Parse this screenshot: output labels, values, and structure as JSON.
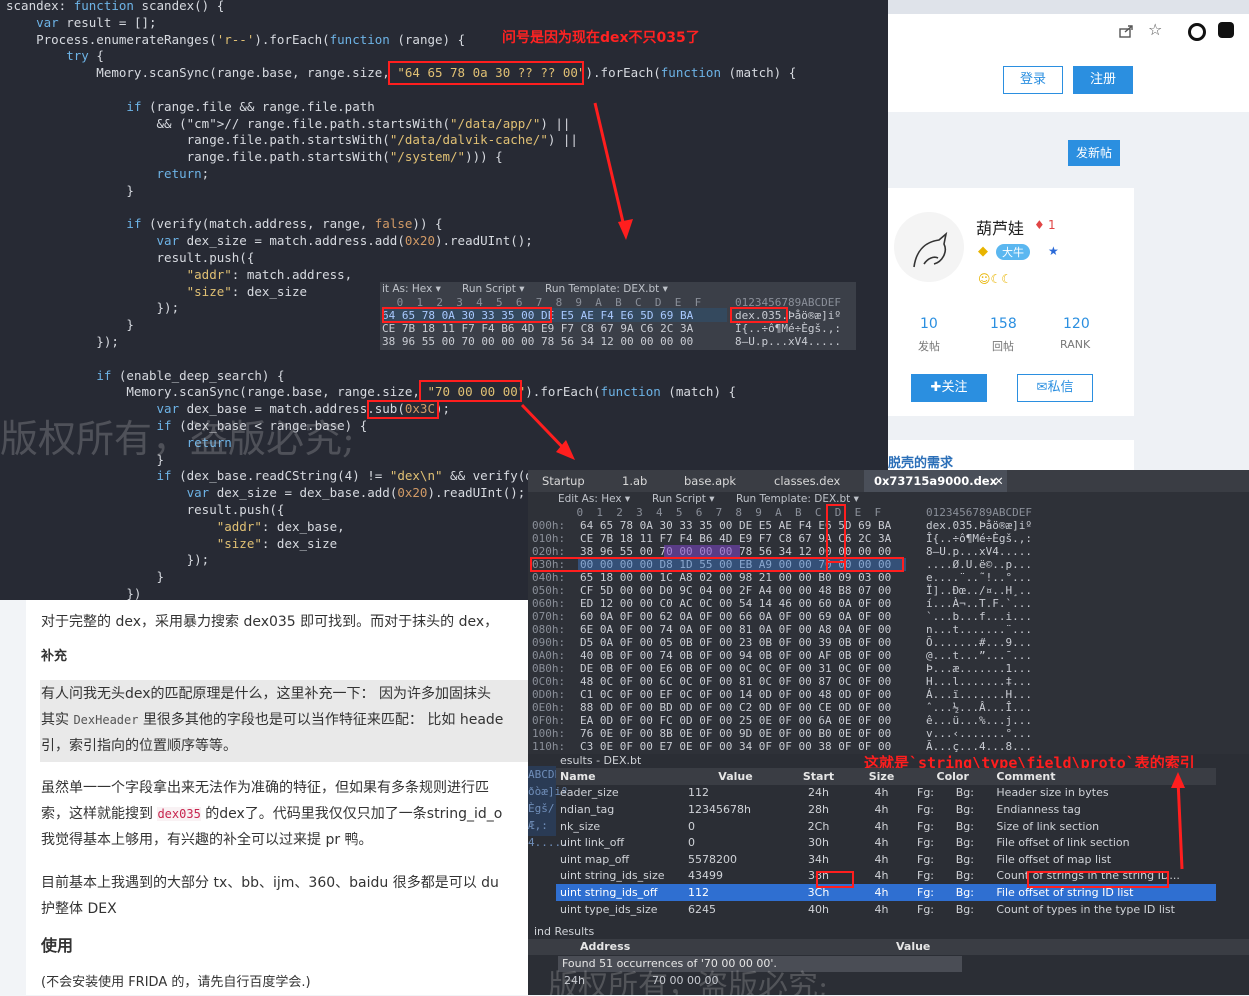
{
  "editor": {
    "lines": [
      "scandex: function scandex() {",
      "    var result = [];",
      "    Process.enumerateRanges('r--').forEach(function (range) {",
      "        try {",
      "            Memory.scanSync(range.base, range.size, \"64 65 78 0a 30 ?? ?? 00\").forEach(function (match) {",
      "",
      "                if (range.file && range.file.path",
      "                    && (// range.file.path.startsWith(\"/data/app/\") ||",
      "                        range.file.path.startsWith(\"/data/dalvik-cache/\") ||",
      "                        range.file.path.startsWith(\"/system/\"))) {",
      "                    return;",
      "                }",
      "",
      "                if (verify(match.address, range, false)) {",
      "                    var dex_size = match.address.add(0x20).readUInt();",
      "                    result.push({",
      "                        \"addr\": match.address,",
      "                        \"size\": dex_size",
      "                    });",
      "                }",
      "            });",
      "",
      "            if (enable_deep_search) {",
      "                Memory.scanSync(range.base, range.size, \"70 00 00 00\").forEach(function (match) {",
      "                    var dex_base = match.address.sub(0x3C);",
      "                    if (dex_base < range.base) {",
      "                        return",
      "                    }",
      "                    if (dex_base.readCString(4) != \"dex\\n\" && verify(d",
      "                        var dex_size = dex_base.add(0x20).readUInt();",
      "                        result.push({",
      "                            \"addr\": dex_base,",
      "                            \"size\": dex_size",
      "                        });",
      "                    }",
      "                })",
      "            }"
    ],
    "annotation_top": "问号是因为现在dex不只035了",
    "watermark": "版权所有，盗版必究;"
  },
  "hexpopup": {
    "toolbar": [
      "it As: Hex ▾",
      "Run Script ▾",
      "Run Template: DEX.bt ▾"
    ],
    "header": " 0  1  2  3  4  5  6  7  8  9  A  B  C  D  E  F",
    "ascii_header": "0123456789ABCDEF",
    "rows": [
      {
        "hex": "64 65 78 0A 30 33 35 00 DE E5 AE F4 E6 5D 69 BA",
        "ascii": "dex.035.Þåö®æ]iº"
      },
      {
        "hex": "CE 7B 18 11 F7 F4 B6 4D E9 F7 C8 67 9A C6 2C 3A",
        "ascii": "Î{..÷ô¶Mé÷Ègš.,:"
      },
      {
        "hex": "38 96 55 00 70 00 00 00 78 56 34 12 00 00 00 00",
        "ascii": "8–U.p...xV4....."
      }
    ]
  },
  "web": {
    "login": "登录",
    "register": "注册",
    "post": "发新帖",
    "username": "葫芦娃",
    "badge_count": "1",
    "rank_badge": "大牛",
    "stats": [
      {
        "value": "10",
        "label": "发帖"
      },
      {
        "value": "158",
        "label": "回帖"
      },
      {
        "value": "120",
        "label": "RANK"
      }
    ],
    "follow": "关注",
    "message": "私信",
    "link_text": "脱壳的需求"
  },
  "article": {
    "p1": "对于完整的 dex，采用暴力搜索 dex035 即可找到。而对于抹头的 dex，",
    "h_supplement": "补充",
    "p2a": "有人问我无头dex的匹配原理是什么，这里补充一下：  因为许多加固抹头",
    "p2b_pre": "其实 ",
    "p2b_code": "DexHeader",
    "p2b_post": " 里很多其他的字段也是可以当作特征来匹配：  比如 heade",
    "p2c": "引，索引指向的位置顺序等等。",
    "p3a": "虽然单一一个字段拿出来无法作为准确的特征，但如果有多条规则进行匹",
    "p3b_pre": "索，这样就能搜到 ",
    "p3b_code": "dex035",
    "p3b_post": " 的dex了。代码里我仅仅只加了一条string_id_o",
    "p3c": "我觉得基本上够用，有兴趣的补全可以过来提 pr 鸭。",
    "p4a": "目前基本上我遇到的大部分 tx、bb、ijm、360、baidu 很多都是可以 du",
    "p4b": "护整体 DEX",
    "h_use": "使用",
    "p5": "(不会安装使用 FRIDA 的，请先自行百度学会.)"
  },
  "hexeditor": {
    "tabs": [
      "Startup",
      "1.ab",
      "base.apk",
      "classes.dex",
      "0x73715a9000.dex"
    ],
    "toolbar": [
      "Edit As: Hex ▾",
      "Run Script ▾",
      "Run Template: DEX.bt ▾"
    ],
    "header": "    0  1  2  3  4  5  6  7  8  9  A  B  C  D  E  F",
    "ascii_header": "0123456789ABCDEF",
    "rows": [
      {
        "addr": "000h:",
        "hex": "64 65 78 0A 30 33 35 00 DE E5 AE F4 E6 5D 69 BA",
        "ascii": "dex.035.Þåö®æ]iº"
      },
      {
        "addr": "010h:",
        "hex": "CE 7B 18 11 F7 F4 B6 4D E9 F7 C8 67 9A C6 2C 3A",
        "ascii": "Î{..÷ô¶Mé÷Ègš.,:"
      },
      {
        "addr": "020h:",
        "hex": "38 96 55 00 70 00 00 00 78 56 34 12 00 00 00 00",
        "ascii": "8–U.p...xV4....."
      },
      {
        "addr": "030h:",
        "hex": "00 00 00 00 D8 1D 55 00 EB A9 00 00 70 00 00 00",
        "ascii": "....Ø.U.ë©..p..."
      },
      {
        "addr": "040h:",
        "hex": "65 18 00 00 1C A8 02 00 98 21 00 00 B0 09 03 00",
        "ascii": "e....¨..˜!..°..."
      },
      {
        "addr": "050h:",
        "hex": "CF 5D 00 00 D0 9C 04 00 2F A4 00 00 48 B8 07 00",
        "ascii": "Ï]..Ðœ../¤..H¸.."
      },
      {
        "addr": "060h:",
        "hex": "ED 12 00 00 C0 AC 0C 00 54 14 46 00 60 0A 0F 00",
        "ascii": "í...À¬..T.F.`..."
      },
      {
        "addr": "070h:",
        "hex": "60 0A 0F 00 62 0A 0F 00 66 0A 0F 00 69 0A 0F 00",
        "ascii": "`...b...f...i..."
      },
      {
        "addr": "080h:",
        "hex": "6E 0A 0F 00 74 0A 0F 00 81 0A 0F 00 A8 0A 0F 00",
        "ascii": "n...t.......¨..."
      },
      {
        "addr": "090h:",
        "hex": "D5 0A 0F 00 05 0B 0F 00 23 0B 0F 00 39 0B 0F 00",
        "ascii": "Õ.......#...9..."
      },
      {
        "addr": "0A0h:",
        "hex": "40 0B 0F 00 74 0B 0F 00 94 0B 0F 00 AF 0B 0F 00",
        "ascii": "@...t...”...¯..."
      },
      {
        "addr": "0B0h:",
        "hex": "DE 0B 0F 00 E6 0B 0F 00 0C 0C 0F 00 31 0C 0F 00",
        "ascii": "Þ...æ.......1..."
      },
      {
        "addr": "0C0h:",
        "hex": "48 0C 0F 00 6C 0C 0F 00 81 0C 0F 00 87 0C 0F 00",
        "ascii": "H...l.......‡..."
      },
      {
        "addr": "0D0h:",
        "hex": "C1 0C 0F 00 EF 0C 0F 00 14 0D 0F 00 48 0D 0F 00",
        "ascii": "Á...ï.......H..."
      },
      {
        "addr": "0E0h:",
        "hex": "88 0D 0F 00 BD 0D 0F 00 C2 0D 0F 00 CE 0D 0F 00",
        "ascii": "ˆ...½...Â...Î..."
      },
      {
        "addr": "0F0h:",
        "hex": "EA 0D 0F 00 FC 0D 0F 00 25 0E 0F 00 6A 0E 0F 00",
        "ascii": "ê...ü...%...j..."
      },
      {
        "addr": "100h:",
        "hex": "76 0E 0F 00 8B 0E 0F 00 9D 0E 0F 00 B0 0E 0F 00",
        "ascii": "v...‹.......°..."
      },
      {
        "addr": "110h:",
        "hex": "C3 0E 0F 00 E7 0E 0F 00 34 0F 0F 00 38 0F 0F 00",
        "ascii": "Ã...ç...4...8..."
      }
    ],
    "template_title": "esults - DEX.bt",
    "annotation": "这就是`string\\type\\field\\proto`表的索引",
    "template_cols": [
      "Name",
      "Value",
      "Start",
      "Size",
      "Color",
      "Comment"
    ],
    "template_rows": [
      {
        "name": "eader_size",
        "value": "112",
        "start": "24h",
        "size": "4h",
        "fg": "Fg:",
        "bg": "Bg:",
        "comment": "Header size in bytes"
      },
      {
        "name": "ndian_tag",
        "value": "12345678h",
        "start": "28h",
        "size": "4h",
        "fg": "Fg:",
        "bg": "Bg:",
        "comment": "Endianness tag"
      },
      {
        "name": "nk_size",
        "value": "0",
        "start": "2Ch",
        "size": "4h",
        "fg": "Fg:",
        "bg": "Bg:",
        "comment": "Size of link section"
      },
      {
        "name": "uint link_off",
        "value": "0",
        "start": "30h",
        "size": "4h",
        "fg": "Fg:",
        "bg": "Bg:",
        "comment": "File offset of link section"
      },
      {
        "name": "uint map_off",
        "value": "5578200",
        "start": "34h",
        "size": "4h",
        "fg": "Fg:",
        "bg": "Bg:",
        "comment": "File offset of map list"
      },
      {
        "name": "uint string_ids_size",
        "value": "43499",
        "start": "38h",
        "size": "4h",
        "fg": "Fg:",
        "bg": "Bg:",
        "comment": "Count of strings in the string ID..."
      },
      {
        "name": "uint string_ids_off",
        "value": "112",
        "start": "3Ch",
        "size": "4h",
        "fg": "Fg:",
        "bg": "Bg:",
        "comment": "File offset of string ID list"
      },
      {
        "name": "uint type_ids_size",
        "value": "6245",
        "start": "40h",
        "size": "4h",
        "fg": "Fg:",
        "bg": "Bg:",
        "comment": "Count of types in the type ID list"
      }
    ],
    "side_ascii": [
      "ABCDEF",
      "ðòæ]iº",
      "Ègš/Æ,:",
      "4....."
    ],
    "find_title": "ind Results",
    "find_cols": [
      "Address",
      "Value"
    ],
    "find_msg": "Found 51 occurrences of '70 00 00 00'.",
    "find_row": {
      "addr": "24h",
      "value": "70 00 00 00"
    }
  },
  "colors": {
    "accent": "#2b8fe0",
    "annotation": "#ff1e1e",
    "editor_bg": "#272a34"
  }
}
